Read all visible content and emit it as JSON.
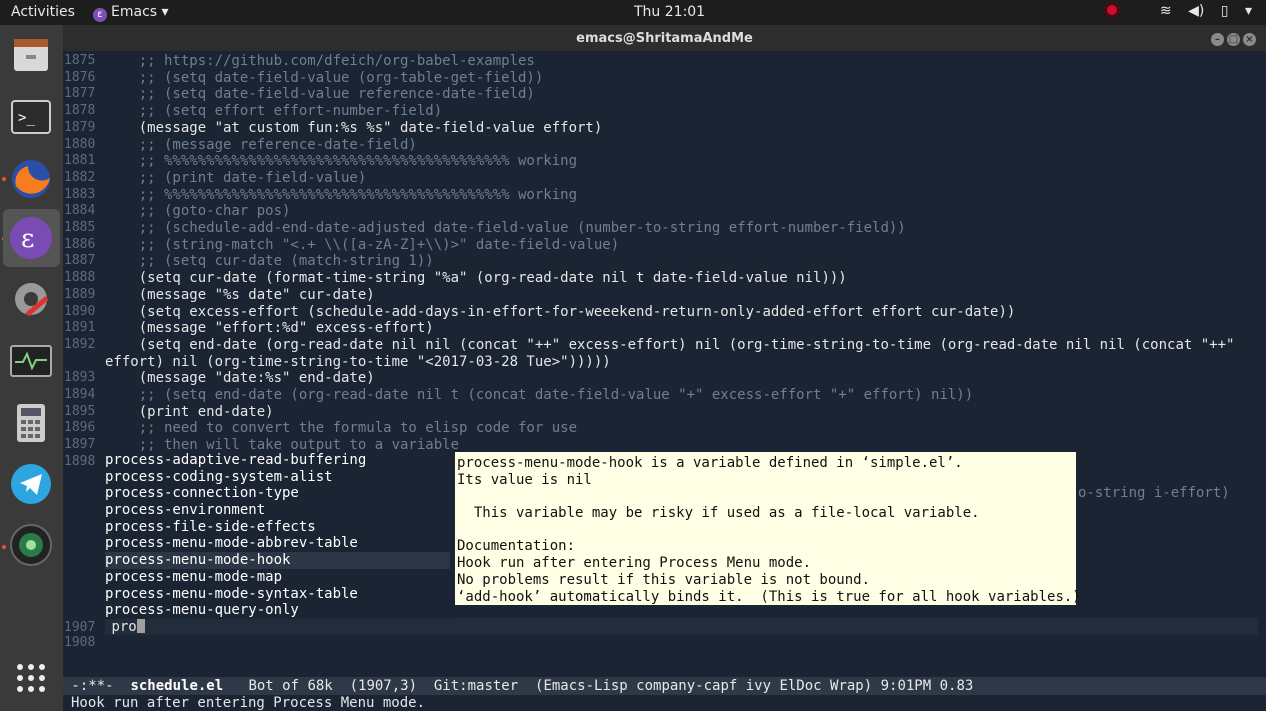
{
  "topbar": {
    "activities": "Activities",
    "app_name": "Emacs",
    "clock": "Thu 21:01"
  },
  "window": {
    "title": "emacs@ShritamaAndMe"
  },
  "dock": [
    "files",
    "terminal",
    "firefox",
    "emacs",
    "settings",
    "system-monitor",
    "calculator",
    "telegram",
    "webcam",
    "show-apps"
  ],
  "editor": {
    "lines": [
      {
        "n": "1875",
        "t": "    ;; https://github.com/dfeich/org-babel-examples",
        "c": true
      },
      {
        "n": "1876",
        "t": "    ;; (setq date-field-value (org-table-get-field))",
        "c": true
      },
      {
        "n": "1877",
        "t": "    ;; (setq date-field-value reference-date-field)",
        "c": true
      },
      {
        "n": "1878",
        "t": "    ;; (setq effort effort-number-field)",
        "c": true
      },
      {
        "n": "1879",
        "t": "    (message \"at custom fun:%s %s\" date-field-value effort)",
        "c": false
      },
      {
        "n": "1880",
        "t": "    ;; (message reference-date-field)",
        "c": true
      },
      {
        "n": "1881",
        "t": "    ;; %%%%%%%%%%%%%%%%%%%%%%%%%%%%%%%%%%%%%%%%% working",
        "c": true
      },
      {
        "n": "1882",
        "t": "    ;; (print date-field-value)",
        "c": true
      },
      {
        "n": "1883",
        "t": "    ;; %%%%%%%%%%%%%%%%%%%%%%%%%%%%%%%%%%%%%%%%% working",
        "c": true
      },
      {
        "n": "1884",
        "t": "    ;; (goto-char pos)",
        "c": true
      },
      {
        "n": "1885",
        "t": "    ;; (schedule-add-end-date-adjusted date-field-value (number-to-string effort-number-field))",
        "c": true
      },
      {
        "n": "1886",
        "t": "    ;; (string-match \"<.+ \\\\([a-zA-Z]+\\\\)>\" date-field-value)",
        "c": true
      },
      {
        "n": "1887",
        "t": "    ;; (setq cur-date (match-string 1))",
        "c": true
      },
      {
        "n": "1888",
        "t": "    (setq cur-date (format-time-string \"%a\" (org-read-date nil t date-field-value nil)))",
        "c": false
      },
      {
        "n": "1889",
        "t": "    (message \"%s date\" cur-date)",
        "c": false
      },
      {
        "n": "1890",
        "t": "    (setq excess-effort (schedule-add-days-in-effort-for-weeekend-return-only-added-effort effort cur-date))",
        "c": false
      },
      {
        "n": "1891",
        "t": "    (message \"effort:%d\" excess-effort)",
        "c": false
      },
      {
        "n": "1892",
        "t": "    (setq end-date (org-read-date nil nil (concat \"++\" excess-effort) nil (org-time-string-to-time (org-read-date nil nil (concat \"++\"",
        "c": false
      },
      {
        "n": "",
        "t": "effort) nil (org-time-string-to-time \"<2017-03-28 Tue>\")))))",
        "c": false
      },
      {
        "n": "1893",
        "t": "    (message \"date:%s\" end-date)",
        "c": false
      },
      {
        "n": "1894",
        "t": "    ;; (setq end-date (org-read-date nil t (concat date-field-value \"+\" excess-effort \"+\" effort) nil))",
        "c": true
      },
      {
        "n": "1895",
        "t": "    (print end-date)",
        "c": false
      },
      {
        "n": "1896",
        "t": "    ;; need to convert the formula to elisp code for use",
        "c": true
      },
      {
        "n": "1897",
        "t": "    ;; then will take output to a variable",
        "c": true
      },
      {
        "n": "1898",
        "t": "",
        "c": false
      }
    ],
    "hidden_tail": "o-string i-effort)",
    "current_line": {
      "n": "1907",
      "t": "pro"
    },
    "last_line": {
      "n": "1908",
      "t": ""
    }
  },
  "completion": {
    "items": [
      "process-adaptive-read-buffering",
      "process-coding-system-alist",
      "process-connection-type",
      "process-environment",
      "process-file-side-effects",
      "process-menu-mode-abbrev-table",
      "process-menu-mode-hook",
      "process-menu-mode-map",
      "process-menu-mode-syntax-table",
      "process-menu-query-only"
    ],
    "selected_index": 6
  },
  "doc_popup": {
    "lines": [
      "process-menu-mode-hook is a variable defined in ‘simple.el’.",
      "Its value is nil",
      "",
      "  This variable may be risky if used as a file-local variable.",
      "",
      "Documentation:",
      "Hook run after entering Process Menu mode.",
      "No problems result if this variable is not bound.",
      "‘add-hook’ automatically binds it.  (This is true for all hook variables.)"
    ]
  },
  "modeline": {
    "state": " -:**-  ",
    "buffer": "schedule.el",
    "rest": "   Bot of 68k  (1907,3)  Git:master  (Emacs-Lisp company-capf ivy ElDoc Wrap) 9:01PM 0.83"
  },
  "echo_area": "Hook run after entering Process Menu mode."
}
